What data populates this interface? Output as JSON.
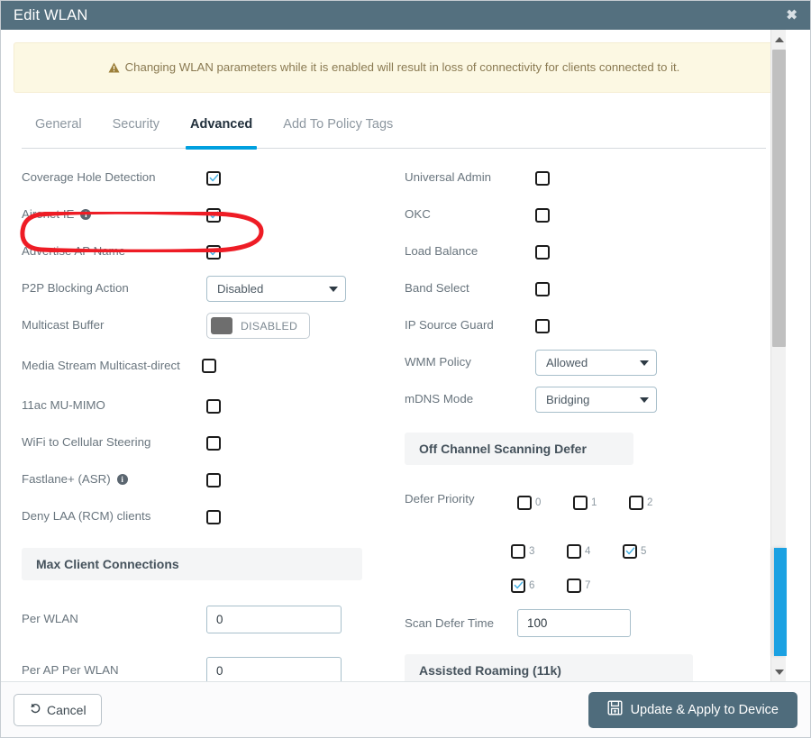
{
  "window": {
    "title": "Edit WLAN",
    "close_label": "✖"
  },
  "warning": {
    "icon": "warning-triangle-icon",
    "text": "Changing WLAN parameters while it is enabled will result in loss of connectivity for clients connected to it."
  },
  "tabs": [
    {
      "label": "General",
      "active": false
    },
    {
      "label": "Security",
      "active": false
    },
    {
      "label": "Advanced",
      "active": true
    },
    {
      "label": "Add To Policy Tags",
      "active": false
    }
  ],
  "left_column": {
    "coverage_hole_detection": {
      "label": "Coverage Hole Detection",
      "checked": true
    },
    "aironet_ie": {
      "label": "Aironet IE",
      "checked": true,
      "info_icon": "info-icon",
      "info_glyph": "i"
    },
    "advertise_ap_name": {
      "label": "Advertise AP Name",
      "checked": true
    },
    "p2p_blocking_action": {
      "label": "P2P Blocking Action",
      "value": "Disabled"
    },
    "multicast_buffer": {
      "label": "Multicast Buffer",
      "state": "DISABLED"
    },
    "media_stream_multicast_direct": {
      "label": "Media Stream Multicast-direct",
      "checked": false
    },
    "mu_mimo": {
      "label": "11ac MU-MIMO",
      "checked": false
    },
    "wifi_to_cellular_steering": {
      "label": "WiFi to Cellular Steering",
      "checked": false
    },
    "fastlane_asr": {
      "label": "Fastlane+ (ASR)",
      "checked": false,
      "info_icon": "info-icon",
      "info_glyph": "i"
    },
    "deny_laa_rcm": {
      "label": "Deny LAA (RCM) clients",
      "checked": false
    },
    "max_client_connections_header": "Max Client Connections",
    "per_wlan": {
      "label": "Per WLAN",
      "value": "0"
    },
    "per_ap_per_wlan": {
      "label": "Per AP Per WLAN",
      "value": "0"
    }
  },
  "right_column": {
    "universal_admin": {
      "label": "Universal Admin",
      "checked": false
    },
    "okc": {
      "label": "OKC",
      "checked": false
    },
    "load_balance": {
      "label": "Load Balance",
      "checked": false
    },
    "band_select": {
      "label": "Band Select",
      "checked": false
    },
    "ip_source_guard": {
      "label": "IP Source Guard",
      "checked": false
    },
    "wmm_policy": {
      "label": "WMM Policy",
      "value": "Allowed"
    },
    "mdns_mode": {
      "label": "mDNS Mode",
      "value": "Bridging"
    },
    "off_channel_scanning_defer_header": "Off Channel Scanning Defer",
    "defer_priority": {
      "label": "Defer Priority",
      "rows": [
        [
          {
            "num": "0",
            "checked": false
          },
          {
            "num": "1",
            "checked": false
          },
          {
            "num": "2",
            "checked": false
          }
        ],
        [
          {
            "num": "3",
            "checked": false
          },
          {
            "num": "4",
            "checked": false
          },
          {
            "num": "5",
            "checked": true
          }
        ],
        [
          {
            "num": "6",
            "checked": true
          },
          {
            "num": "7",
            "checked": false
          }
        ]
      ]
    },
    "scan_defer_time": {
      "label": "Scan Defer Time",
      "value": "100"
    },
    "assisted_roaming_header": "Assisted Roaming (11k)"
  },
  "footer": {
    "cancel_label": "Cancel",
    "cancel_icon": "undo-arrow-icon",
    "update_label": "Update & Apply to Device",
    "update_icon": "save-disk-icon"
  },
  "scrollbar": {
    "up_arrow_icon": "triangle-up-icon",
    "down_arrow_icon": "triangle-down-icon"
  },
  "colors": {
    "titlebar": "#54707f",
    "accent_blue": "#00a0df",
    "warning_bg": "#fcf8e3",
    "primary_button": "#4f6c7c",
    "annotation_red": "#ee1c25",
    "edge_tab_blue": "#1ba1e2"
  }
}
